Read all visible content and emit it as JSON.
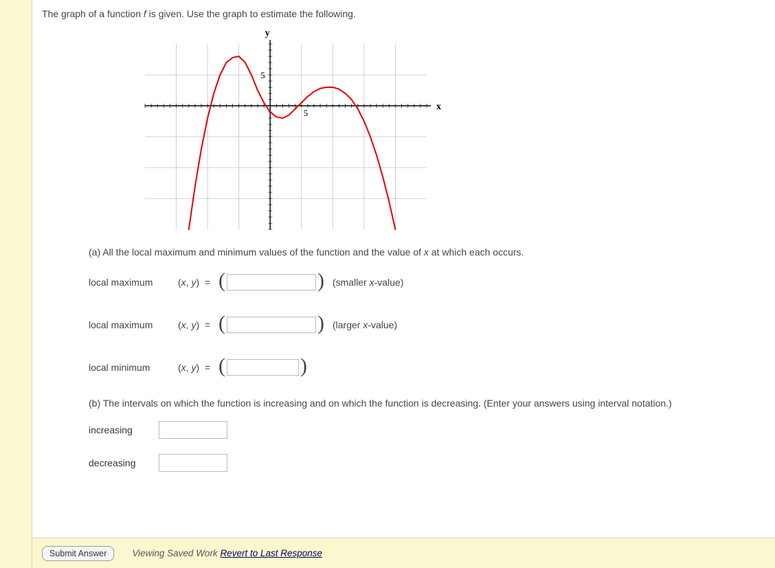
{
  "prompt_before": "The graph of a function ",
  "prompt_fvar": "f",
  "prompt_after": " is given. Use the graph to estimate the following.",
  "part_a_before": "(a) All the local maximum and minimum values of the function and the value of ",
  "part_a_xvar": "x",
  "part_a_after": " at which each occurs.",
  "rows": {
    "r1_label": "local maximum",
    "r2_label": "local maximum",
    "r3_label": "local minimum",
    "xy_eq": "(x, y) = ",
    "open": "(",
    "close": ")",
    "note_smaller_before": "(smaller ",
    "note_smaller_var": "x",
    "note_smaller_after": "-value)",
    "note_larger_before": "(larger ",
    "note_larger_var": "x",
    "note_larger_after": "-value)"
  },
  "part_b": "(b) The intervals on which the function is increasing and on which the function is decreasing. (Enter your answers using interval notation.)",
  "increasing_label": "increasing",
  "decreasing_label": "decreasing",
  "submit_label": "Submit Answer",
  "viewing_text": "Viewing Saved Work ",
  "revert_link": "Revert to Last Response",
  "chart_data": {
    "type": "line",
    "title": "",
    "xlabel": "x",
    "ylabel": "y",
    "xlim": [
      -20,
      25
    ],
    "ylim": [
      -20,
      10
    ],
    "xticks": [
      5
    ],
    "yticks": [
      5
    ],
    "series": [
      {
        "name": "f",
        "color": "#e30000",
        "points": [
          {
            "x": -13,
            "y": -20
          },
          {
            "x": -12,
            "y": -13
          },
          {
            "x": -11,
            "y": -7
          },
          {
            "x": -10,
            "y": -2
          },
          {
            "x": -9,
            "y": 2
          },
          {
            "x": -8,
            "y": 5
          },
          {
            "x": -7,
            "y": 7
          },
          {
            "x": -6,
            "y": 7.8
          },
          {
            "x": -5,
            "y": 8
          },
          {
            "x": -4,
            "y": 7
          },
          {
            "x": -3,
            "y": 5
          },
          {
            "x": -2,
            "y": 2.5
          },
          {
            "x": -1,
            "y": 0.5
          },
          {
            "x": 0,
            "y": -1
          },
          {
            "x": 1,
            "y": -1.8
          },
          {
            "x": 2,
            "y": -2
          },
          {
            "x": 3,
            "y": -1.5
          },
          {
            "x": 4,
            "y": -0.5
          },
          {
            "x": 5,
            "y": 0.5
          },
          {
            "x": 6,
            "y": 1.5
          },
          {
            "x": 7,
            "y": 2.3
          },
          {
            "x": 8,
            "y": 2.8
          },
          {
            "x": 9,
            "y": 3
          },
          {
            "x": 10,
            "y": 3
          },
          {
            "x": 11,
            "y": 2.7
          },
          {
            "x": 12,
            "y": 2
          },
          {
            "x": 13,
            "y": 1
          },
          {
            "x": 14,
            "y": -0.5
          },
          {
            "x": 15,
            "y": -2.5
          },
          {
            "x": 16,
            "y": -5
          },
          {
            "x": 17,
            "y": -8
          },
          {
            "x": 18,
            "y": -11.5
          },
          {
            "x": 19,
            "y": -15.5
          },
          {
            "x": 20,
            "y": -20
          }
        ]
      }
    ]
  }
}
